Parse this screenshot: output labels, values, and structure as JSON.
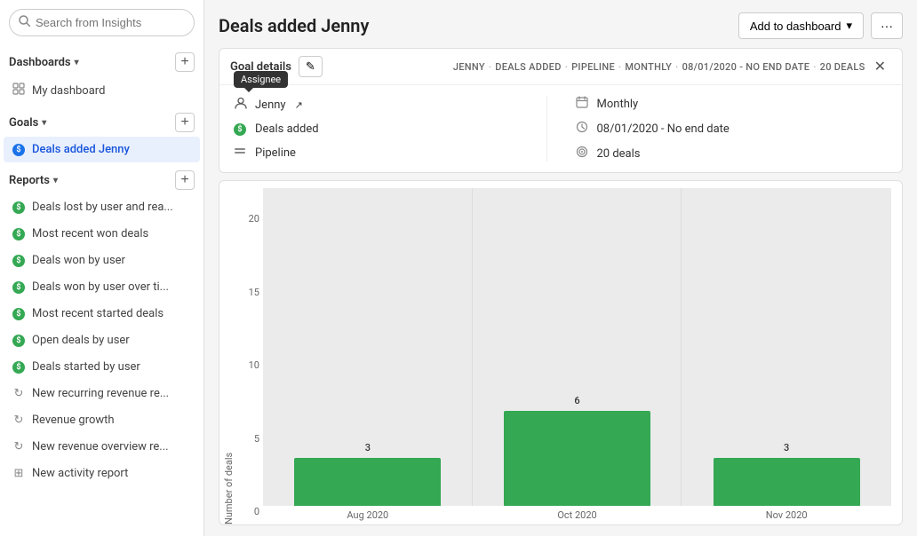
{
  "sidebar": {
    "search_placeholder": "Search from Insights",
    "dashboards_label": "Dashboards",
    "my_dashboard_label": "My dashboard",
    "goals_label": "Goals",
    "active_goal_label": "Deals added Jenny",
    "reports_label": "Reports",
    "report_items": [
      {
        "label": "Deals lost by user and rea...",
        "icon": "dollar"
      },
      {
        "label": "Most recent won deals",
        "icon": "dollar"
      },
      {
        "label": "Deals won by user",
        "icon": "dollar"
      },
      {
        "label": "Deals won by user over ti...",
        "icon": "dollar"
      },
      {
        "label": "Most recent started deals",
        "icon": "dollar"
      },
      {
        "label": "Open deals by user",
        "icon": "dollar"
      },
      {
        "label": "Deals started by user",
        "icon": "dollar"
      },
      {
        "label": "New recurring revenue re...",
        "icon": "refresh"
      },
      {
        "label": "Revenue growth",
        "icon": "refresh"
      },
      {
        "label": "New revenue overview re...",
        "icon": "refresh"
      },
      {
        "label": "New activity report",
        "icon": "grid"
      }
    ]
  },
  "main": {
    "title": "Deals added Jenny",
    "add_dashboard_label": "Add to dashboard",
    "more_label": "···"
  },
  "goal_details": {
    "title": "Goal details",
    "edit_icon": "✎",
    "breadcrumb": {
      "jenny": "JENNY",
      "deals_added": "DEALS ADDED",
      "pipeline": "PIPELINE",
      "monthly": "MONTHLY",
      "date_range": "08/01/2020 - NO END DATE",
      "deals": "20 DEALS"
    },
    "assignee_tooltip": "Assignee",
    "assignee_name": "Jenny",
    "metric_label": "Deals added",
    "pipeline_label": "Pipeline",
    "monthly_label": "Monthly",
    "date_label": "08/01/2020 - No end date",
    "deals_label": "20 deals"
  },
  "chart": {
    "y_label": "Number of deals",
    "goal_value": 20,
    "goal_symbol": "🎯",
    "bars": [
      {
        "month": "Aug 2020",
        "value": 3,
        "goal": 20
      },
      {
        "month": "Oct 2020",
        "value": 6,
        "goal": 20
      },
      {
        "month": "Nov 2020",
        "value": 3,
        "goal": 20
      }
    ],
    "y_ticks": [
      "20",
      "15",
      "10",
      "5",
      "0"
    ]
  }
}
